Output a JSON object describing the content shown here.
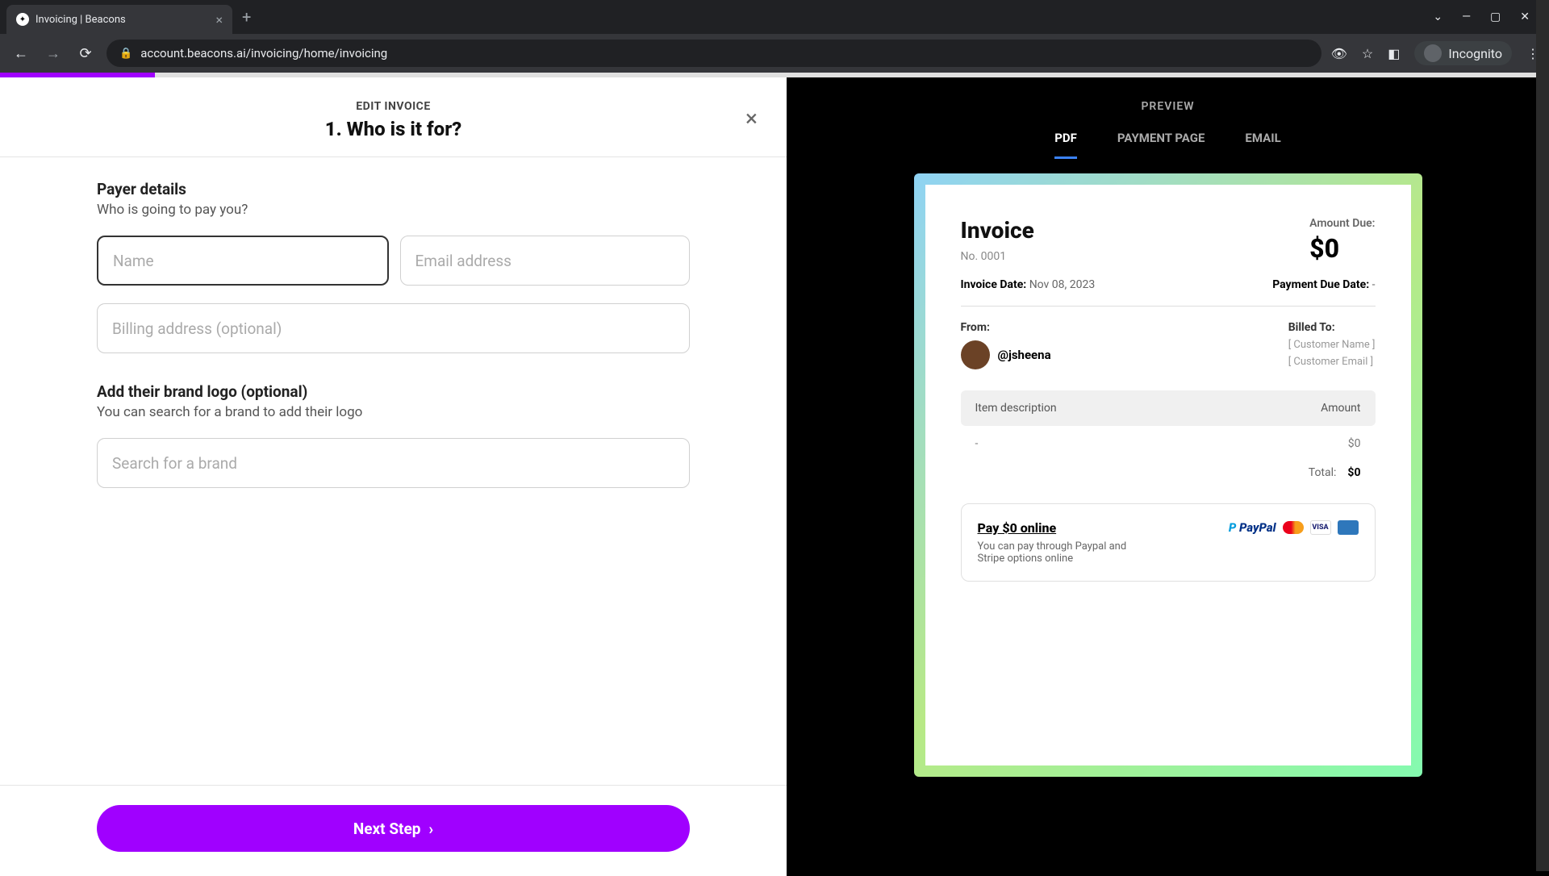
{
  "browser": {
    "tab_title": "Invoicing | Beacons",
    "url": "account.beacons.ai/invoicing/home/invoicing",
    "incognito_label": "Incognito"
  },
  "header": {
    "eyebrow": "EDIT INVOICE",
    "title": "1. Who is it for?"
  },
  "form": {
    "payer_title": "Payer details",
    "payer_sub": "Who is going to pay you?",
    "name_placeholder": "Name",
    "email_placeholder": "Email address",
    "billing_placeholder": "Billing address (optional)",
    "logo_title": "Add their brand logo (optional)",
    "logo_sub": "You can search for a brand to add their logo",
    "brand_placeholder": "Search for a brand"
  },
  "footer": {
    "next_label": "Next Step"
  },
  "preview": {
    "label": "PREVIEW",
    "tabs": {
      "pdf": "PDF",
      "payment": "PAYMENT PAGE",
      "email": "EMAIL"
    }
  },
  "invoice": {
    "title": "Invoice",
    "number": "No. 0001",
    "amount_due_label": "Amount Due:",
    "amount_due_value": "$0",
    "invoice_date_label": "Invoice Date:",
    "invoice_date_value": "Nov 08, 2023",
    "payment_due_label": "Payment Due Date:",
    "payment_due_value": "-",
    "from_label": "From:",
    "from_handle": "@jsheena",
    "billed_label": "Billed To:",
    "cust_name_ph": "[ Customer Name ]",
    "cust_email_ph": "[ Customer Email ]",
    "col_desc": "Item description",
    "col_amount": "Amount",
    "item_desc": "-",
    "item_amount": "$0",
    "total_label": "Total:",
    "total_value": "$0",
    "pay_title": "Pay $0 online",
    "pay_sub": "You can pay through Paypal and Stripe options online",
    "visa": "VISA"
  }
}
